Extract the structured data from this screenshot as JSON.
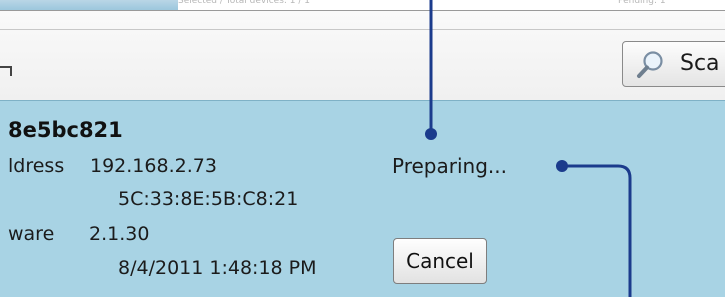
{
  "colors": {
    "panel": "#a8d3e4",
    "toolbar": "#f5f5f5",
    "callout": "#1b3b8c"
  },
  "header": {
    "faint_left": "Selected / Total devices: 1 / 1",
    "faint_right": "Pending: 1"
  },
  "toolbar": {
    "scan_label": "Sca",
    "scan_icon": "magnifier-icon"
  },
  "device": {
    "name": "8e5bc821",
    "address_label": "ldress",
    "ip": "192.168.2.73",
    "mac": "5C:33:8E:5B:C8:21",
    "firmware_label": "ware",
    "firmware": "2.1.30",
    "date": "8/4/2011 1:48:18 PM",
    "status": "Preparing...",
    "cancel_label": "Cancel"
  }
}
